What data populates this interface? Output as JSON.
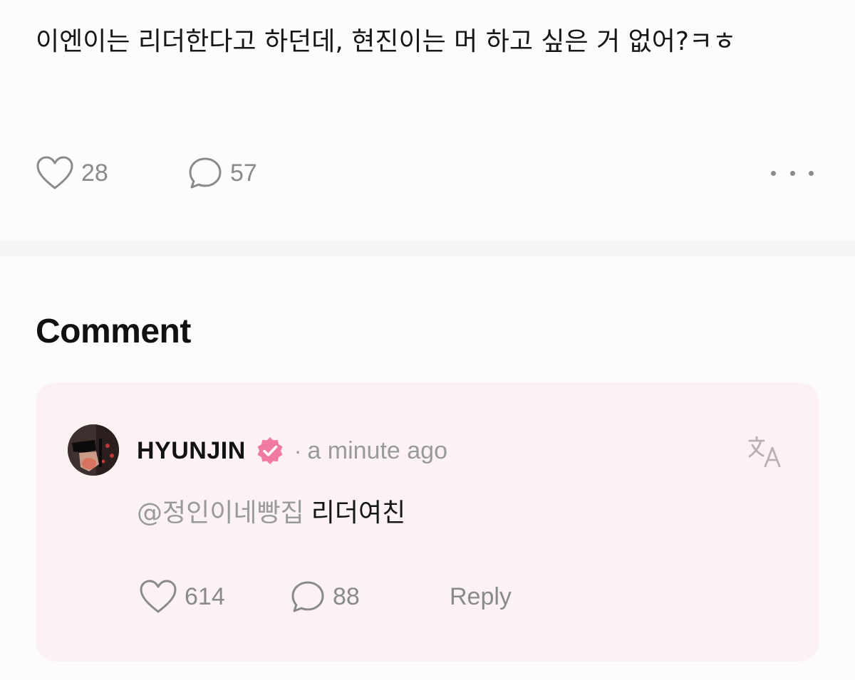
{
  "post": {
    "text": "이엔이는 리더한다고 하던데, 현진이는 머 하고 싶은 거 없어?ㅋㅎ",
    "like_count": "28",
    "comment_count": "57",
    "like_icon": "heart-icon",
    "comment_icon": "speech-bubble-icon",
    "more_icon": "more-dots-icon"
  },
  "comments_section": {
    "title": "Comment"
  },
  "comment": {
    "author": "HYUNJIN",
    "verified_icon": "verified-badge-icon",
    "verified_color": "#f07aa0",
    "separator": "·",
    "timestamp": "a minute ago",
    "translate_icon": "translate-icon",
    "mention": "@정인이네빵집",
    "text": "리더여친",
    "like_count": "614",
    "reply_count": "88",
    "reply_label": "Reply"
  },
  "colors": {
    "background": "#fdfbfb",
    "card_background": "#fcf2f4",
    "muted_text": "#8a8a8a"
  }
}
